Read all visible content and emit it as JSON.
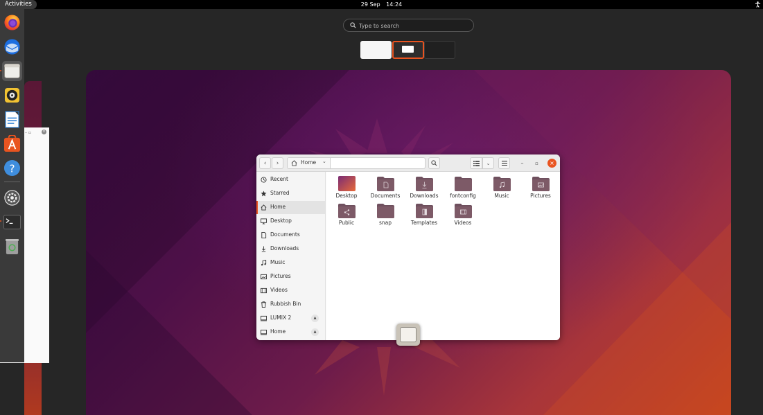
{
  "topbar": {
    "activities_label": "Activities",
    "date": "29 Sep",
    "time": "14:24",
    "system_icon": "accessibility-icon"
  },
  "search": {
    "placeholder": "Type to search"
  },
  "dock": {
    "items": [
      {
        "name": "firefox",
        "icon": "firefox-icon"
      },
      {
        "name": "thunderbird",
        "icon": "thunderbird-icon"
      },
      {
        "name": "files",
        "icon": "files-icon",
        "active": true
      },
      {
        "name": "rhythmbox",
        "icon": "rhythmbox-icon"
      },
      {
        "name": "libreoffice-writer",
        "icon": "writer-icon"
      },
      {
        "name": "ubuntu-software",
        "icon": "software-icon"
      },
      {
        "name": "help",
        "icon": "help-icon"
      },
      {
        "name": "settings",
        "icon": "settings-icon"
      },
      {
        "name": "terminal",
        "icon": "terminal-icon"
      },
      {
        "name": "trash",
        "icon": "trash-icon"
      }
    ]
  },
  "files_window": {
    "path_label": "Home",
    "sidebar": [
      {
        "label": "Recent",
        "icon": "clock-icon"
      },
      {
        "label": "Starred",
        "icon": "star-icon"
      },
      {
        "label": "Home",
        "icon": "home-icon",
        "active": true
      },
      {
        "label": "Desktop",
        "icon": "desktop-icon"
      },
      {
        "label": "Documents",
        "icon": "document-icon"
      },
      {
        "label": "Downloads",
        "icon": "download-icon"
      },
      {
        "label": "Music",
        "icon": "music-icon"
      },
      {
        "label": "Pictures",
        "icon": "picture-icon"
      },
      {
        "label": "Videos",
        "icon": "video-icon"
      },
      {
        "label": "Rubbish Bin",
        "icon": "trash-icon"
      },
      {
        "label": "LUMIX 2",
        "icon": "drive-icon",
        "eject": true
      },
      {
        "label": "Home",
        "icon": "drive-icon",
        "eject": true
      }
    ],
    "files": [
      {
        "name": "Desktop",
        "emblem": "desktop"
      },
      {
        "name": "Documents",
        "emblem": "document"
      },
      {
        "name": "Downloads",
        "emblem": "download"
      },
      {
        "name": "fontconfig",
        "emblem": "none"
      },
      {
        "name": "Music",
        "emblem": "music"
      },
      {
        "name": "Pictures",
        "emblem": "picture"
      },
      {
        "name": "Public",
        "emblem": "share"
      },
      {
        "name": "snap",
        "emblem": "none"
      },
      {
        "name": "Templates",
        "emblem": "template"
      },
      {
        "name": "Videos",
        "emblem": "video"
      }
    ]
  },
  "colors": {
    "accent": "#e95420",
    "folder": "#7d5a67"
  }
}
